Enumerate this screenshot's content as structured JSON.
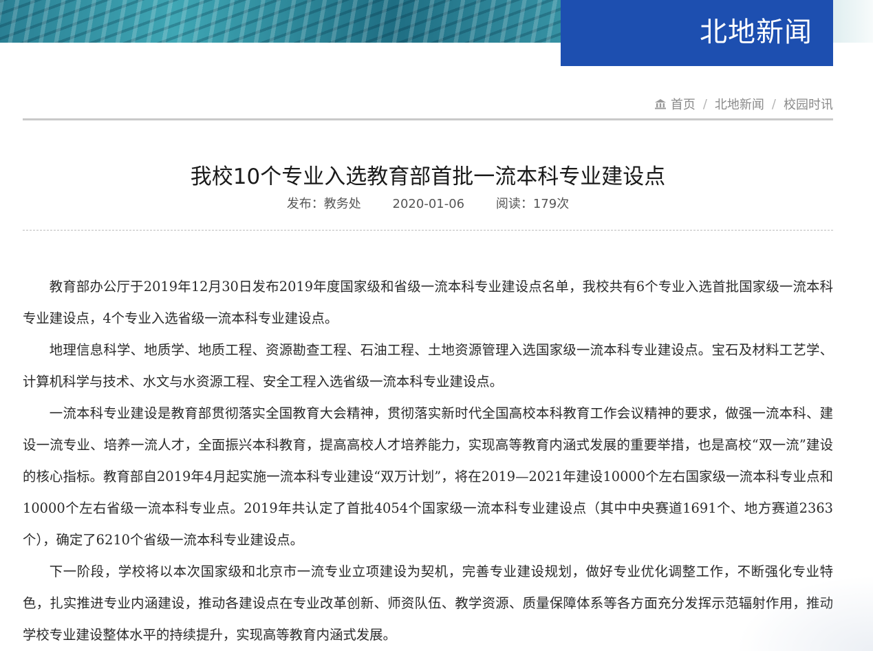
{
  "header": {
    "section_title": "北地新闻"
  },
  "breadcrumb": {
    "items": [
      "首页",
      "北地新闻",
      "校园时讯"
    ],
    "separator": "/"
  },
  "article": {
    "title": "我校10个专业入选教育部首批一流本科专业建设点",
    "meta": {
      "publisher": "发布：教务处",
      "date": "2020-01-06",
      "views": "阅读：179次"
    },
    "paragraphs": [
      "教育部办公厅于2019年12月30日发布2019年度国家级和省级一流本科专业建设点名单，我校共有6个专业入选首批国家级一流本科专业建设点，4个专业入选省级一流本科专业建设点。",
      "地理信息科学、地质学、地质工程、资源勘查工程、石油工程、土地资源管理入选国家级一流本科专业建设点。宝石及材料工艺学、计算机科学与技术、水文与水资源工程、安全工程入选省级一流本科专业建设点。",
      "一流本科专业建设是教育部贯彻落实全国教育大会精神，贯彻落实新时代全国高校本科教育工作会议精神的要求，做强一流本科、建设一流专业、培养一流人才，全面振兴本科教育，提高高校人才培养能力，实现高等教育内涵式发展的重要举措，也是高校“双一流”建设的核心指标。教育部自2019年4月起实施一流本科专业建设“双万计划”，将在2019—2021年建设10000个左右国家级一流本科专业点和10000个左右省级一流本科专业点。2019年共认定了首批4054个国家级一流本科专业建设点（其中中央赛道1691个、地方赛道2363个），确定了6210个省级一流本科专业建设点。",
      "下一阶段，学校将以本次国家级和北京市一流专业立项建设为契机，完善专业建设规划，做好专业优化调整工作，不断强化专业特色，扎实推进专业内涵建设，推动各建设点在专业改革创新、师资队伍、教学资源、质量保障体系等各方面充分发挥示范辐射作用，推动学校专业建设整体水平的持续提升，实现高等教育内涵式发展。"
    ]
  },
  "colors": {
    "section_box": "#1d4fb0",
    "banner": "#2a7f93",
    "rule": "#c9c9c9"
  },
  "icons": {
    "home": "home-icon"
  }
}
